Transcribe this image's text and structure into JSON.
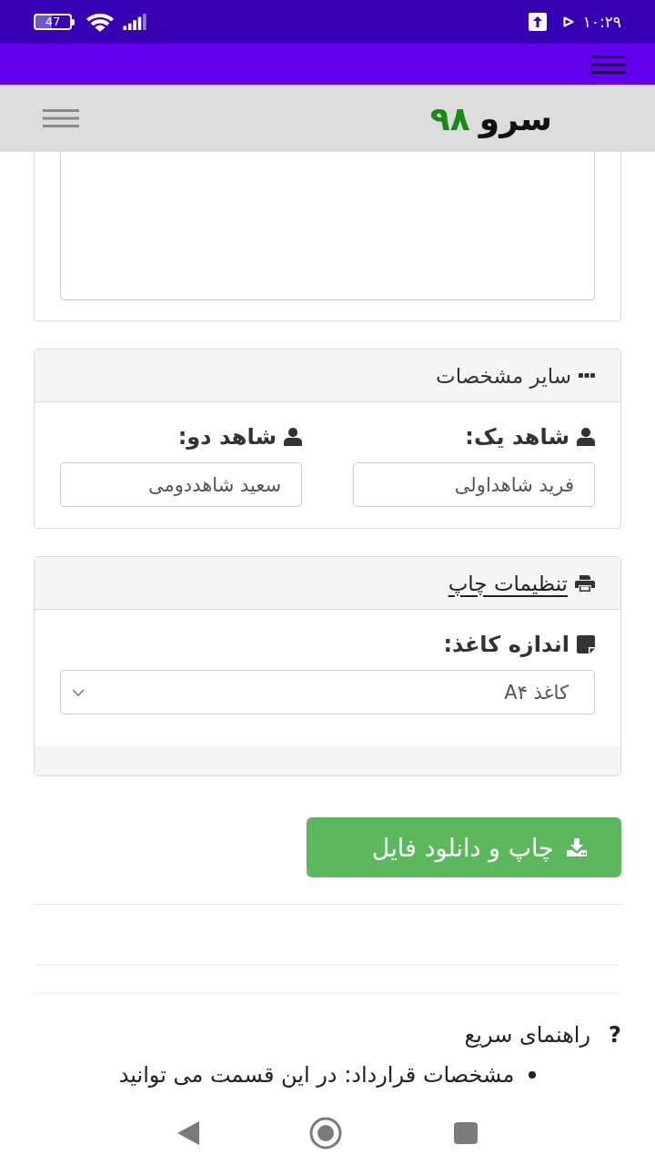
{
  "status_bar": {
    "battery": "47",
    "time": "۱۰:۲۹"
  },
  "header": {
    "logo_word": "سرو",
    "logo_number": "۹۸"
  },
  "other_details": {
    "title": "سایر مشخصات",
    "fields": [
      {
        "label": "شاهد یک:",
        "value": "فرید شاهداولی"
      },
      {
        "label": "شاهد دو:",
        "value": "سعید شاهددومی"
      }
    ]
  },
  "print_settings": {
    "title": "تنظیمات چاپ",
    "field": {
      "label": "اندازه کاغذ:",
      "value": "کاغذ A۴"
    }
  },
  "download_button": {
    "label": "چاپ و دانلود فایل"
  },
  "quick_help": {
    "icon": "?",
    "title": "راهنمای سریع",
    "items": [
      "مشخصات قرارداد: در این قسمت می توانید"
    ]
  }
}
